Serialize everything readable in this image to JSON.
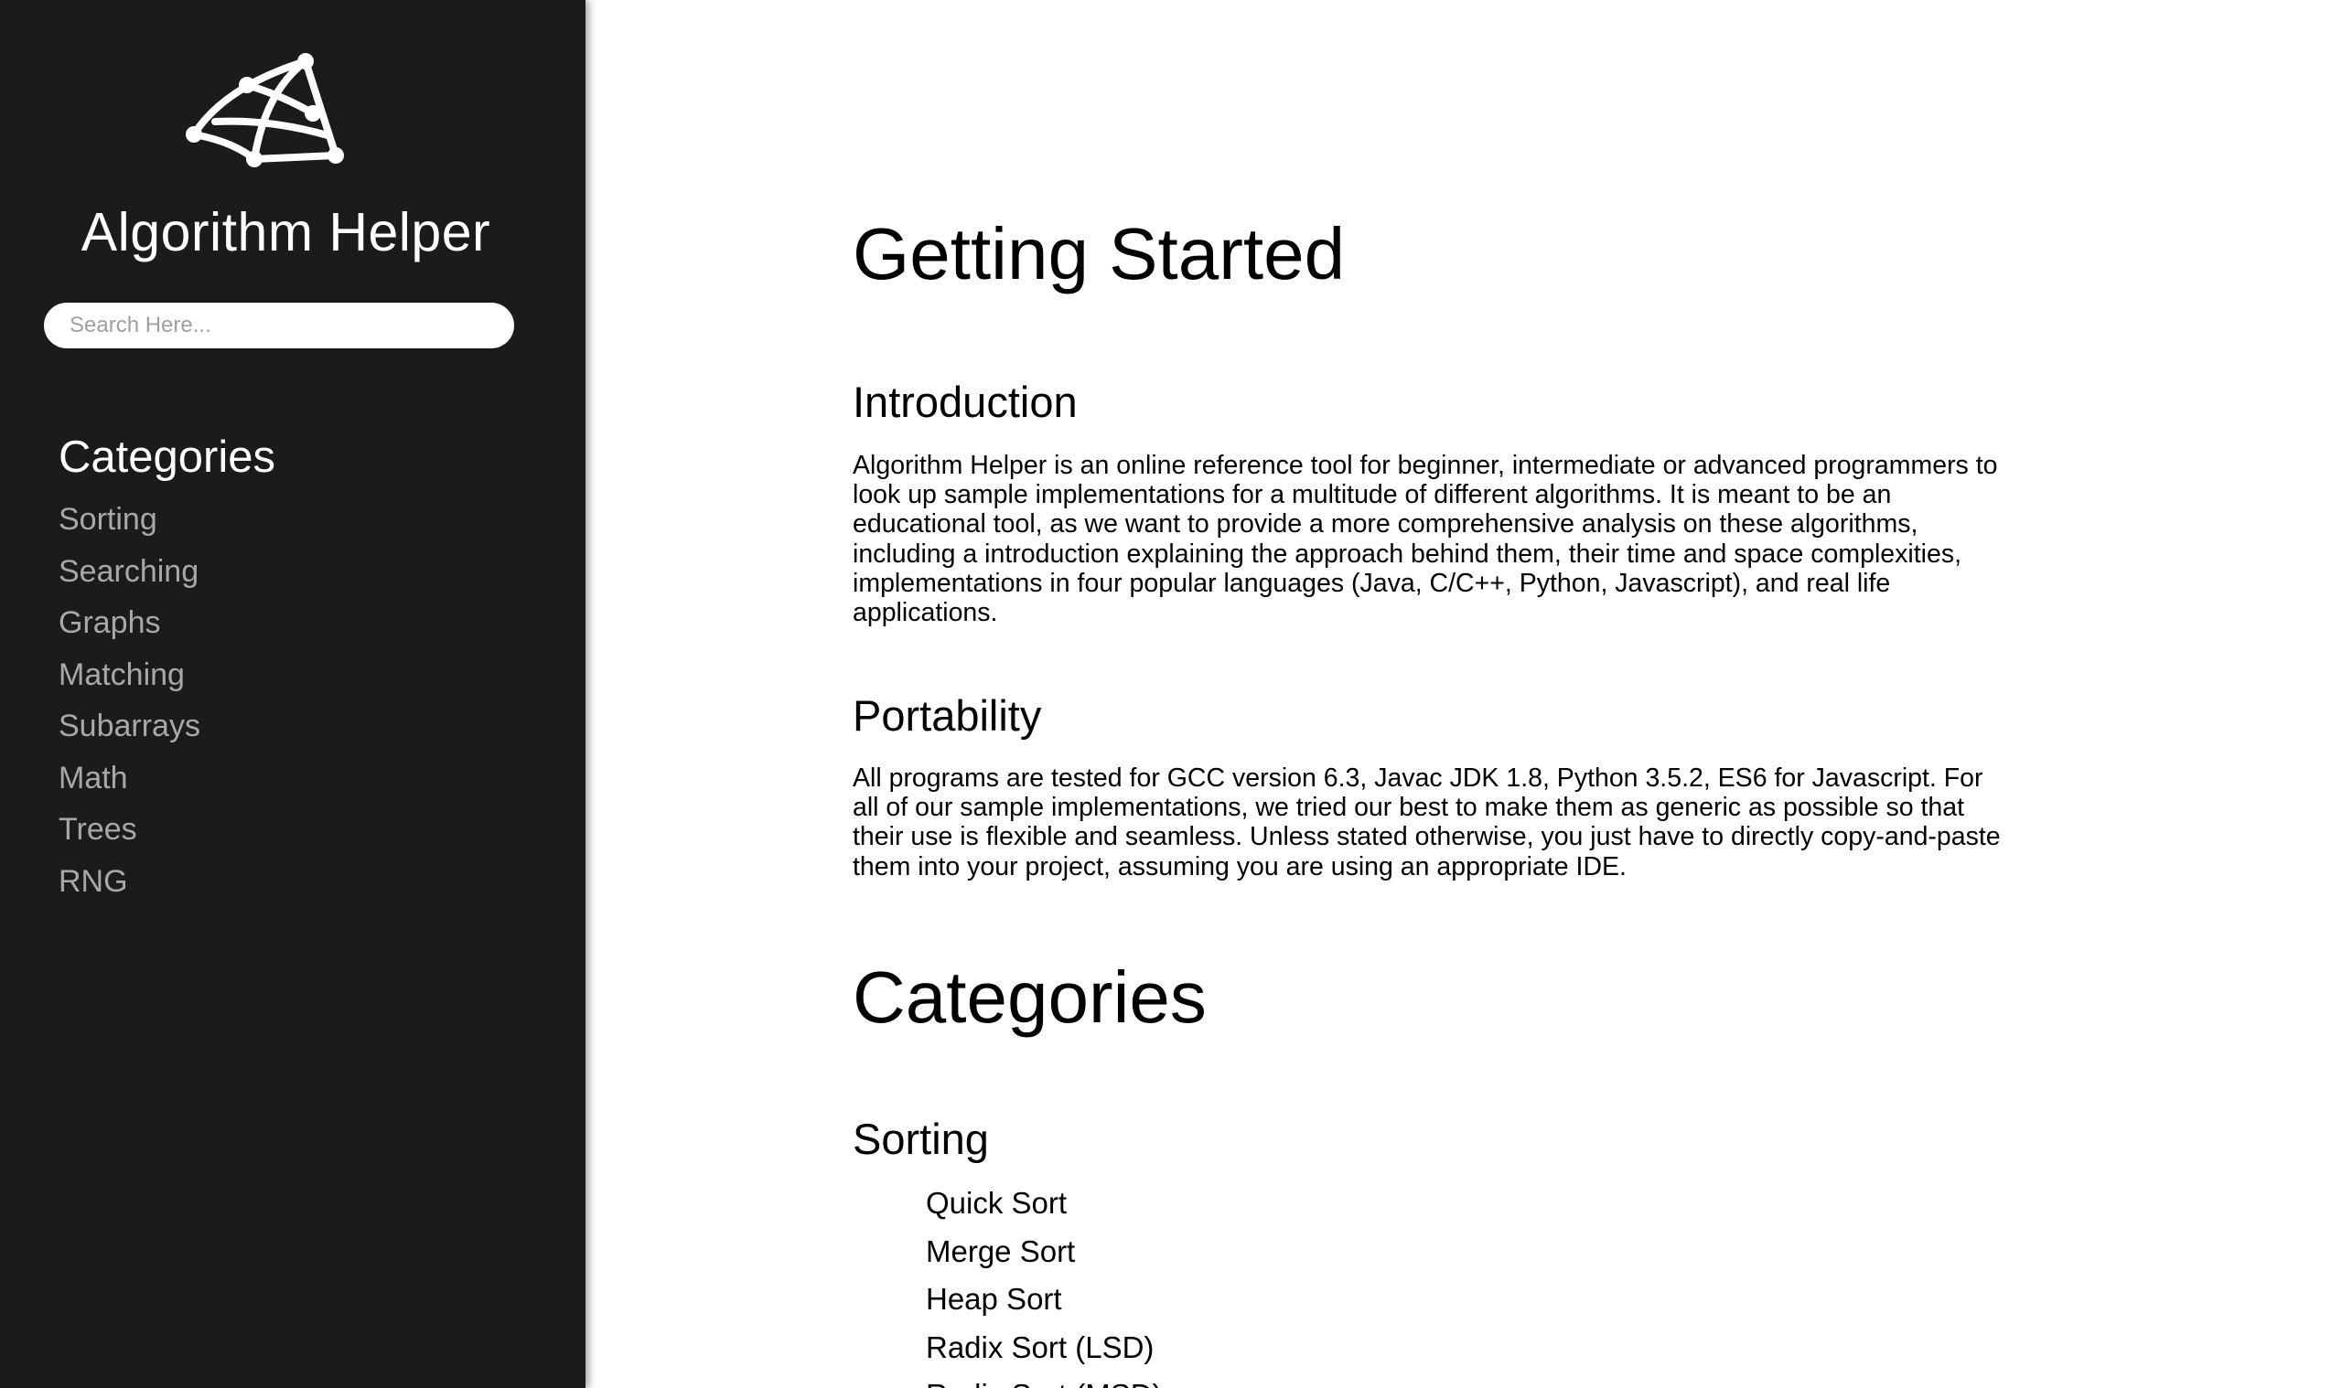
{
  "sidebar": {
    "logo_icon": "algorithm-helper-logo",
    "app_title": "Algorithm Helper",
    "search": {
      "placeholder": "Search Here..."
    },
    "categories_heading": "Categories",
    "items": [
      "Sorting",
      "Searching",
      "Graphs",
      "Matching",
      "Subarrays",
      "Math",
      "Trees",
      "RNG"
    ]
  },
  "main": {
    "page_title": "Getting Started",
    "intro": {
      "heading": "Introduction",
      "text": "Algorithm Helper is an online reference tool for beginner, intermediate or advanced programmers to look up sample implementations for a multitude of different algorithms. It is meant to be an educational tool, as we want to provide a more comprehensive analysis on these algorithms, including a introduction explaining the approach behind them, their time and space complexities, implementations in four popular languages (Java, C/C++, Python, Javascript), and real life applications."
    },
    "portability": {
      "heading": "Portability",
      "text": "All programs are tested for GCC version 6.3, Javac JDK 1.8, Python 3.5.2, ES6 for Javascript. For all of our sample implementations, we tried our best to make them as generic as possible so that their use is flexible and seamless. Unless stated otherwise, you just have to directly copy-and-paste them into your project, assuming you are using an appropriate IDE."
    },
    "categories_title": "Categories",
    "sorting": {
      "heading": "Sorting",
      "items": [
        "Quick Sort",
        "Merge Sort",
        "Heap Sort",
        "Radix Sort (LSD)",
        "Radix Sort (MSD)"
      ]
    }
  },
  "colors": {
    "sidebar_bg": "#1b1b1b",
    "sidebar_text": "#ffffff",
    "sidebar_item_text": "#a8a8a8",
    "content_text": "#000000",
    "page_bg": "#ffffff"
  }
}
